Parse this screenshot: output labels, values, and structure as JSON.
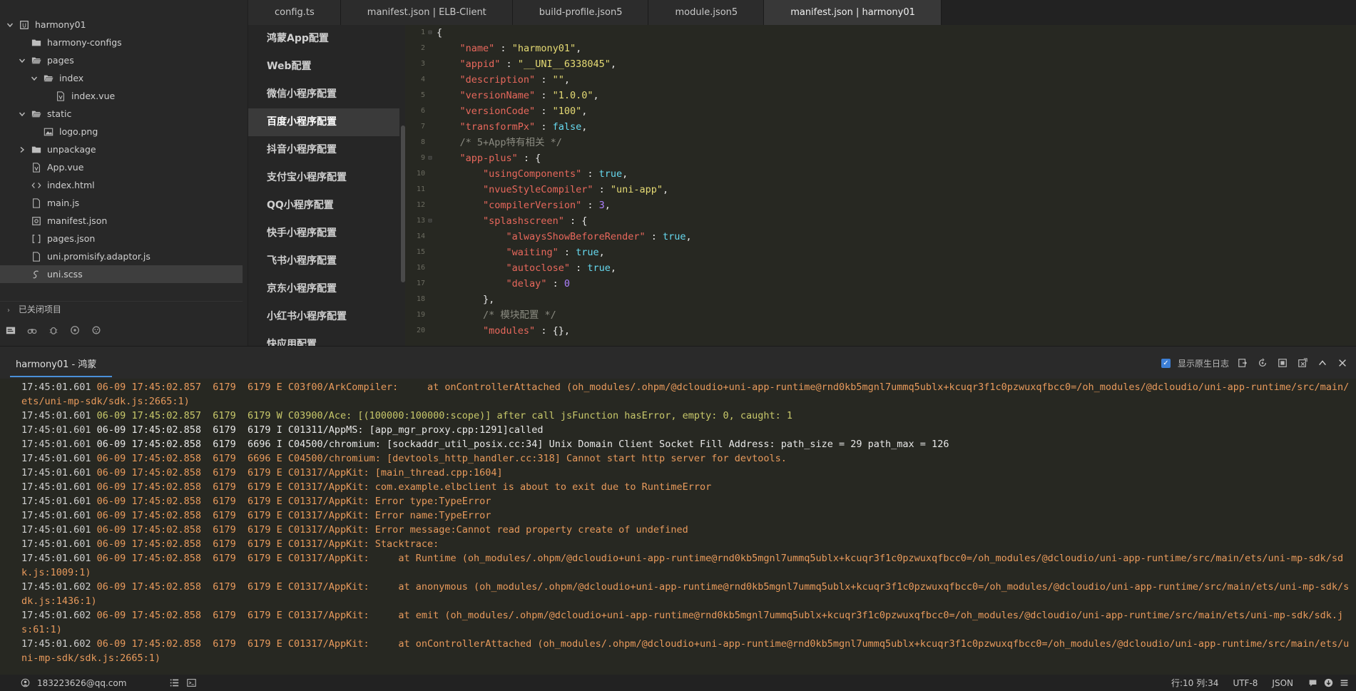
{
  "explorer": {
    "tree": [
      {
        "label": "harmony01",
        "indent": 0,
        "arrow": "down",
        "icon": "project"
      },
      {
        "label": "harmony-configs",
        "indent": 1,
        "arrow": "none",
        "icon": "folder"
      },
      {
        "label": "pages",
        "indent": 1,
        "arrow": "down",
        "icon": "folder-open"
      },
      {
        "label": "index",
        "indent": 2,
        "arrow": "down",
        "icon": "folder-open"
      },
      {
        "label": "index.vue",
        "indent": 3,
        "arrow": "none",
        "icon": "vue"
      },
      {
        "label": "static",
        "indent": 1,
        "arrow": "down",
        "icon": "folder-open"
      },
      {
        "label": "logo.png",
        "indent": 2,
        "arrow": "none",
        "icon": "image"
      },
      {
        "label": "unpackage",
        "indent": 1,
        "arrow": "right",
        "icon": "folder"
      },
      {
        "label": "App.vue",
        "indent": 1,
        "arrow": "none",
        "icon": "vue"
      },
      {
        "label": "index.html",
        "indent": 1,
        "arrow": "none",
        "icon": "html"
      },
      {
        "label": "main.js",
        "indent": 1,
        "arrow": "none",
        "icon": "file"
      },
      {
        "label": "manifest.json",
        "indent": 1,
        "arrow": "none",
        "icon": "manifest"
      },
      {
        "label": "pages.json",
        "indent": 1,
        "arrow": "none",
        "icon": "json"
      },
      {
        "label": "uni.promisify.adaptor.js",
        "indent": 1,
        "arrow": "none",
        "icon": "file"
      },
      {
        "label": "uni.scss",
        "indent": 1,
        "arrow": "none",
        "icon": "scss",
        "selected": true
      }
    ],
    "closed_projects": "已关闭项目"
  },
  "tabs": [
    {
      "label": "config.ts"
    },
    {
      "label": "manifest.json | ELB-Client"
    },
    {
      "label": "build-profile.json5"
    },
    {
      "label": "module.json5"
    },
    {
      "label": "manifest.json | harmony01",
      "active": true
    }
  ],
  "config_nav": [
    {
      "label": "鸿蒙App配置"
    },
    {
      "label": "Web配置"
    },
    {
      "label": "微信小程序配置"
    },
    {
      "label": "百度小程序配置",
      "active": true
    },
    {
      "label": "抖音小程序配置"
    },
    {
      "label": "支付宝小程序配置"
    },
    {
      "label": "QQ小程序配置"
    },
    {
      "label": "快手小程序配置"
    },
    {
      "label": "飞书小程序配置"
    },
    {
      "label": "京东小程序配置"
    },
    {
      "label": "小红书小程序配置"
    },
    {
      "label": "快应用配置"
    }
  ],
  "editor": {
    "lines": [
      {
        "n": "1",
        "fold": "⊟",
        "parts": [
          [
            "p",
            "{"
          ]
        ]
      },
      {
        "n": "2",
        "fold": "",
        "parts": [
          [
            "p",
            "    "
          ],
          [
            "k",
            "\"name\""
          ],
          [
            "p",
            " : "
          ],
          [
            "s",
            "\"harmony01\""
          ],
          [
            "p",
            ","
          ]
        ]
      },
      {
        "n": "3",
        "fold": "",
        "parts": [
          [
            "p",
            "    "
          ],
          [
            "k",
            "\"appid\""
          ],
          [
            "p",
            " : "
          ],
          [
            "s",
            "\"__UNI__6338045\""
          ],
          [
            "p",
            ","
          ]
        ]
      },
      {
        "n": "4",
        "fold": "",
        "parts": [
          [
            "p",
            "    "
          ],
          [
            "k",
            "\"description\""
          ],
          [
            "p",
            " : "
          ],
          [
            "s",
            "\"\""
          ],
          [
            "p",
            ","
          ]
        ]
      },
      {
        "n": "5",
        "fold": "",
        "parts": [
          [
            "p",
            "    "
          ],
          [
            "k",
            "\"versionName\""
          ],
          [
            "p",
            " : "
          ],
          [
            "s",
            "\"1.0.0\""
          ],
          [
            "p",
            ","
          ]
        ]
      },
      {
        "n": "6",
        "fold": "",
        "parts": [
          [
            "p",
            "    "
          ],
          [
            "k",
            "\"versionCode\""
          ],
          [
            "p",
            " : "
          ],
          [
            "s",
            "\"100\""
          ],
          [
            "p",
            ","
          ]
        ]
      },
      {
        "n": "7",
        "fold": "",
        "parts": [
          [
            "p",
            "    "
          ],
          [
            "k",
            "\"transformPx\""
          ],
          [
            "p",
            " : "
          ],
          [
            "b",
            "false"
          ],
          [
            "p",
            ","
          ]
        ]
      },
      {
        "n": "8",
        "fold": "",
        "parts": [
          [
            "p",
            "    "
          ],
          [
            "c",
            "/* 5+App特有相关 */"
          ]
        ]
      },
      {
        "n": "9",
        "fold": "⊟",
        "parts": [
          [
            "p",
            "    "
          ],
          [
            "k",
            "\"app-plus\""
          ],
          [
            "p",
            " : {"
          ]
        ]
      },
      {
        "n": "10",
        "fold": "",
        "parts": [
          [
            "p",
            "        "
          ],
          [
            "k",
            "\"usingComponents\""
          ],
          [
            "p",
            " : "
          ],
          [
            "b",
            "true"
          ],
          [
            "p",
            ","
          ]
        ]
      },
      {
        "n": "11",
        "fold": "",
        "parts": [
          [
            "p",
            "        "
          ],
          [
            "k",
            "\"nvueStyleCompiler\""
          ],
          [
            "p",
            " : "
          ],
          [
            "s",
            "\"uni-app\""
          ],
          [
            "p",
            ","
          ]
        ]
      },
      {
        "n": "12",
        "fold": "",
        "parts": [
          [
            "p",
            "        "
          ],
          [
            "k",
            "\"compilerVersion\""
          ],
          [
            "p",
            " : "
          ],
          [
            "n",
            "3"
          ],
          [
            "p",
            ","
          ]
        ]
      },
      {
        "n": "13",
        "fold": "⊟",
        "parts": [
          [
            "p",
            "        "
          ],
          [
            "k",
            "\"splashscreen\""
          ],
          [
            "p",
            " : {"
          ]
        ]
      },
      {
        "n": "14",
        "fold": "",
        "parts": [
          [
            "p",
            "            "
          ],
          [
            "k",
            "\"alwaysShowBeforeRender\""
          ],
          [
            "p",
            " : "
          ],
          [
            "b",
            "true"
          ],
          [
            "p",
            ","
          ]
        ]
      },
      {
        "n": "15",
        "fold": "",
        "parts": [
          [
            "p",
            "            "
          ],
          [
            "k",
            "\"waiting\""
          ],
          [
            "p",
            " : "
          ],
          [
            "b",
            "true"
          ],
          [
            "p",
            ","
          ]
        ]
      },
      {
        "n": "16",
        "fold": "",
        "parts": [
          [
            "p",
            "            "
          ],
          [
            "k",
            "\"autoclose\""
          ],
          [
            "p",
            " : "
          ],
          [
            "b",
            "true"
          ],
          [
            "p",
            ","
          ]
        ]
      },
      {
        "n": "17",
        "fold": "",
        "parts": [
          [
            "p",
            "            "
          ],
          [
            "k",
            "\"delay\""
          ],
          [
            "p",
            " : "
          ],
          [
            "n",
            "0"
          ]
        ]
      },
      {
        "n": "18",
        "fold": "",
        "parts": [
          [
            "p",
            "        },"
          ]
        ]
      },
      {
        "n": "19",
        "fold": "",
        "parts": [
          [
            "p",
            "        "
          ],
          [
            "c",
            "/* 模块配置 */"
          ]
        ]
      },
      {
        "n": "20",
        "fold": "",
        "parts": [
          [
            "p",
            "        "
          ],
          [
            "k",
            "\"modules\""
          ],
          [
            "p",
            " : {},"
          ]
        ]
      }
    ]
  },
  "console": {
    "tab_label": "harmony01 - 鸿蒙",
    "show_native_log": "显示原生日志",
    "lines": [
      {
        "level": "err",
        "ts": "17:45:01.601",
        "text": " 06-09 17:45:02.857  6179  6179 E C03f00/ArkCompiler:     at onControllerAttached (oh_modules/.ohpm/@dcloudio+uni-app-runtime@rnd0kb5mgnl7ummq5ublx+kcuqr3f1c0pzwuxqfbcc0=/oh_modules/@dcloudio/uni-app-runtime/src/main/ets/uni-mp-sdk/sdk.js:2665:1)"
      },
      {
        "level": "warn",
        "ts": "17:45:01.601",
        "text": " 06-09 17:45:02.857  6179  6179 W C03900/Ace: [(100000:100000:scope)] after call jsFunction hasError, empty: 0, caught: 1"
      },
      {
        "level": "info",
        "ts": "17:45:01.601",
        "text": " 06-09 17:45:02.858  6179  6179 I C01311/AppMS: [app_mgr_proxy.cpp:1291]called"
      },
      {
        "level": "info",
        "ts": "17:45:01.601",
        "text": " 06-09 17:45:02.858  6179  6696 I C04500/chromium: [sockaddr_util_posix.cc:34] Unix Domain Client Socket Fill Address: path_size = 29 path_max = 126"
      },
      {
        "level": "err",
        "ts": "17:45:01.601",
        "text": " 06-09 17:45:02.858  6179  6696 E C04500/chromium: [devtools_http_handler.cc:318] Cannot start http server for devtools."
      },
      {
        "level": "err",
        "ts": "17:45:01.601",
        "text": " 06-09 17:45:02.858  6179  6179 E C01317/AppKit: [main_thread.cpp:1604]"
      },
      {
        "level": "err",
        "ts": "17:45:01.601",
        "text": " 06-09 17:45:02.858  6179  6179 E C01317/AppKit: com.example.elbclient is about to exit due to RuntimeError"
      },
      {
        "level": "err",
        "ts": "17:45:01.601",
        "text": " 06-09 17:45:02.858  6179  6179 E C01317/AppKit: Error type:TypeError"
      },
      {
        "level": "err",
        "ts": "17:45:01.601",
        "text": " 06-09 17:45:02.858  6179  6179 E C01317/AppKit: Error name:TypeError"
      },
      {
        "level": "err",
        "ts": "17:45:01.601",
        "text": " 06-09 17:45:02.858  6179  6179 E C01317/AppKit: Error message:Cannot read property create of undefined"
      },
      {
        "level": "err",
        "ts": "17:45:01.601",
        "text": " 06-09 17:45:02.858  6179  6179 E C01317/AppKit: Stacktrace:"
      },
      {
        "level": "err",
        "ts": "17:45:01.601",
        "text": " 06-09 17:45:02.858  6179  6179 E C01317/AppKit:     at Runtime (oh_modules/.ohpm/@dcloudio+uni-app-runtime@rnd0kb5mgnl7ummq5ublx+kcuqr3f1c0pzwuxqfbcc0=/oh_modules/@dcloudio/uni-app-runtime/src/main/ets/uni-mp-sdk/sdk.js:1009:1)"
      },
      {
        "level": "err",
        "ts": "17:45:01.602",
        "text": " 06-09 17:45:02.858  6179  6179 E C01317/AppKit:     at anonymous (oh_modules/.ohpm/@dcloudio+uni-app-runtime@rnd0kb5mgnl7ummq5ublx+kcuqr3f1c0pzwuxqfbcc0=/oh_modules/@dcloudio/uni-app-runtime/src/main/ets/uni-mp-sdk/sdk.js:1436:1)"
      },
      {
        "level": "err",
        "ts": "17:45:01.602",
        "text": " 06-09 17:45:02.858  6179  6179 E C01317/AppKit:     at emit (oh_modules/.ohpm/@dcloudio+uni-app-runtime@rnd0kb5mgnl7ummq5ublx+kcuqr3f1c0pzwuxqfbcc0=/oh_modules/@dcloudio/uni-app-runtime/src/main/ets/uni-mp-sdk/sdk.js:61:1)"
      },
      {
        "level": "err",
        "ts": "17:45:01.602",
        "text": " 06-09 17:45:02.858  6179  6179 E C01317/AppKit:     at onControllerAttached (oh_modules/.ohpm/@dcloudio+uni-app-runtime@rnd0kb5mgnl7ummq5ublx+kcuqr3f1c0pzwuxqfbcc0=/oh_modules/@dcloudio/uni-app-runtime/src/main/ets/uni-mp-sdk/sdk.js:2665:1)"
      }
    ]
  },
  "statusbar": {
    "user": "183223626@qq.com",
    "position": "行:10  列:34",
    "encoding": "UTF-8",
    "language": "JSON"
  },
  "colors": {
    "accent": "#4a90d9",
    "error_log": "#e89a5c",
    "warn_log": "#c8c86a"
  }
}
